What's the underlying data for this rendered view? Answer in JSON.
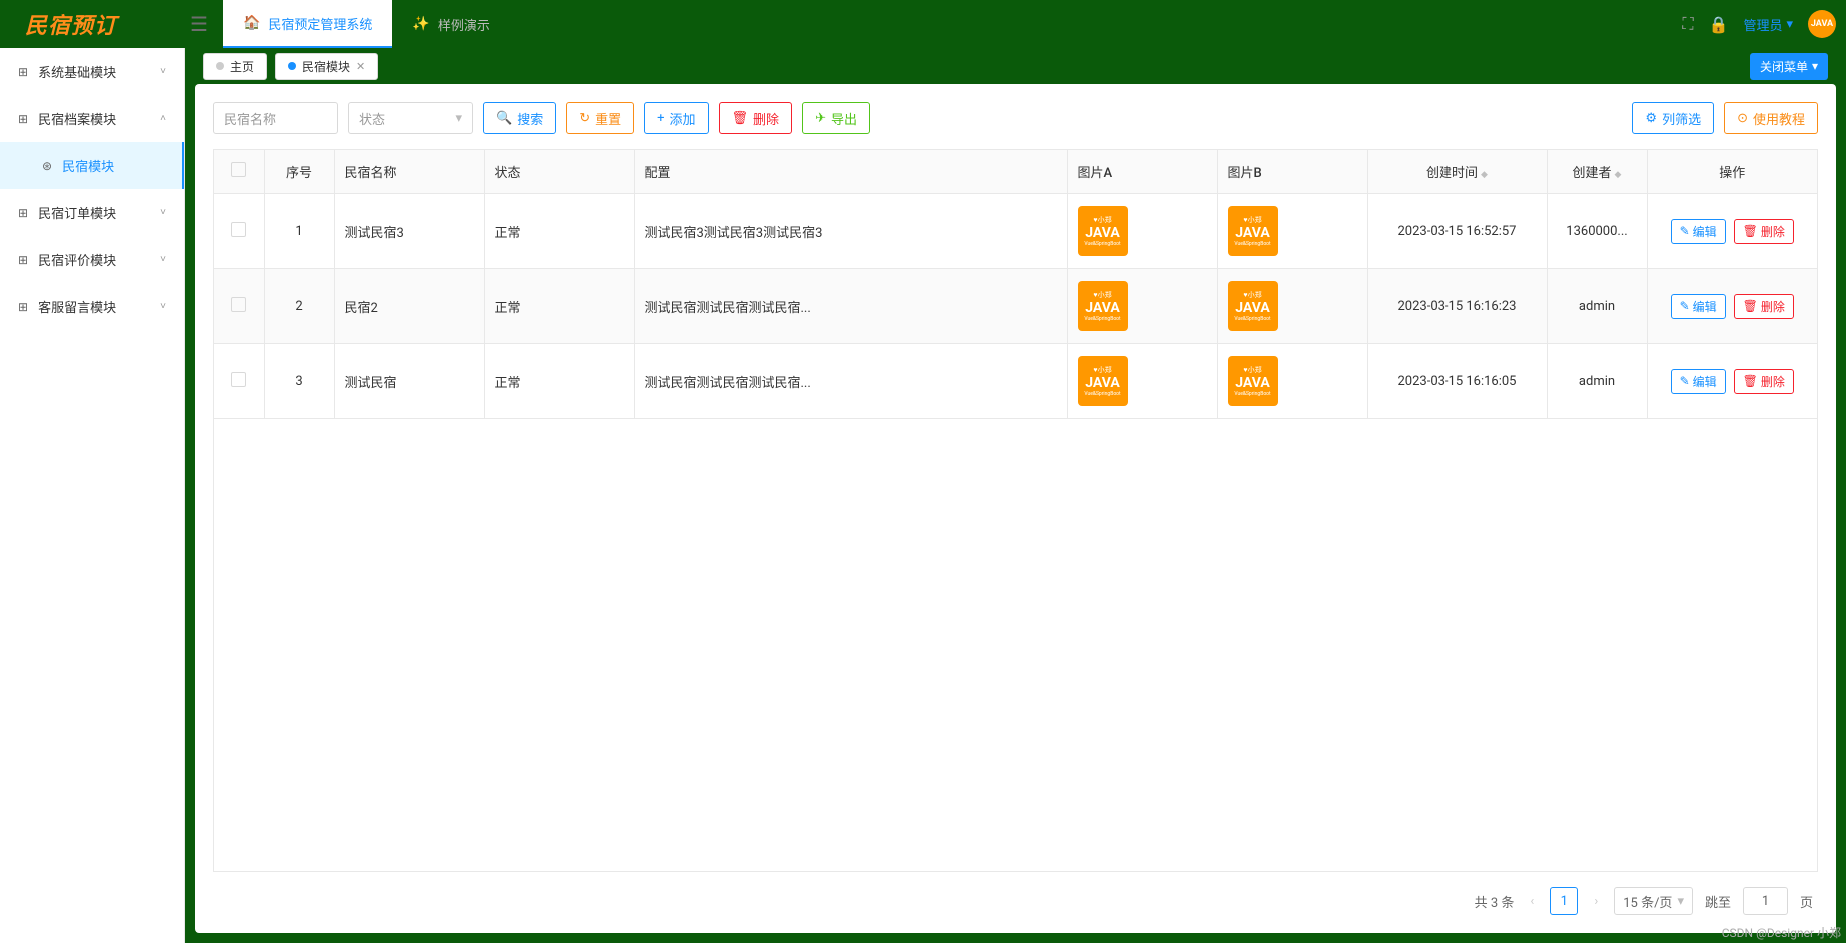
{
  "brand": "民宿预订",
  "top_tabs": [
    {
      "label": "民宿预定管理系统",
      "icon": "🏠",
      "active": true
    },
    {
      "label": "样例演示",
      "icon": "✨",
      "active": false
    }
  ],
  "user": {
    "name": "管理员",
    "caret": "▾"
  },
  "sidebar": [
    {
      "label": "系统基础模块",
      "arrow": "˅",
      "icon": "⊞",
      "sub": false
    },
    {
      "label": "民宿档案模块",
      "arrow": "˄",
      "icon": "⊞",
      "sub": false
    },
    {
      "label": "民宿模块",
      "arrow": "",
      "icon": "⊛",
      "sub": true
    },
    {
      "label": "民宿订单模块",
      "arrow": "˅",
      "icon": "⊞",
      "sub": false
    },
    {
      "label": "民宿评价模块",
      "arrow": "˅",
      "icon": "⊞",
      "sub": false
    },
    {
      "label": "客服留言模块",
      "arrow": "˅",
      "icon": "⊞",
      "sub": false
    }
  ],
  "page_tabs": [
    {
      "label": "主页",
      "active": false,
      "closable": false
    },
    {
      "label": "民宿模块",
      "active": true,
      "closable": true
    }
  ],
  "close_menu": "关闭菜单",
  "filters": {
    "name_placeholder": "民宿名称",
    "status_placeholder": "状态"
  },
  "buttons": {
    "search": "搜索",
    "reset": "重置",
    "add": "添加",
    "delete": "删除",
    "export": "导出",
    "col_filter": "列筛选",
    "tutorial": "使用教程",
    "edit": "编辑",
    "row_delete": "删除"
  },
  "columns": {
    "check": "",
    "seq": "序号",
    "name": "民宿名称",
    "status": "状态",
    "config": "配置",
    "imgA": "图片A",
    "imgB": "图片B",
    "created": "创建时间",
    "creator": "创建者",
    "action": "操作"
  },
  "rows": [
    {
      "seq": "1",
      "name": "测试民宿3",
      "status": "正常",
      "config": "测试民宿3测试民宿3测试民宿3",
      "created": "2023-03-15 16:52:57",
      "creator": "1360000..."
    },
    {
      "seq": "2",
      "name": "民宿2",
      "status": "正常",
      "config": "测试民宿测试民宿测试民宿...",
      "created": "2023-03-15 16:16:23",
      "creator": "admin"
    },
    {
      "seq": "3",
      "name": "测试民宿",
      "status": "正常",
      "config": "测试民宿测试民宿测试民宿...",
      "created": "2023-03-15 16:16:05",
      "creator": "admin"
    }
  ],
  "thumb": {
    "top": "♥小郑",
    "mid": "JAVA",
    "bot": "Vue&SpringBoot"
  },
  "pagination": {
    "total": "共 3 条",
    "page": "1",
    "size": "15 条/页",
    "jump": "跳至",
    "jump_val": "1",
    "suffix": "页"
  },
  "watermark": "CSDN @Designer 小郑"
}
